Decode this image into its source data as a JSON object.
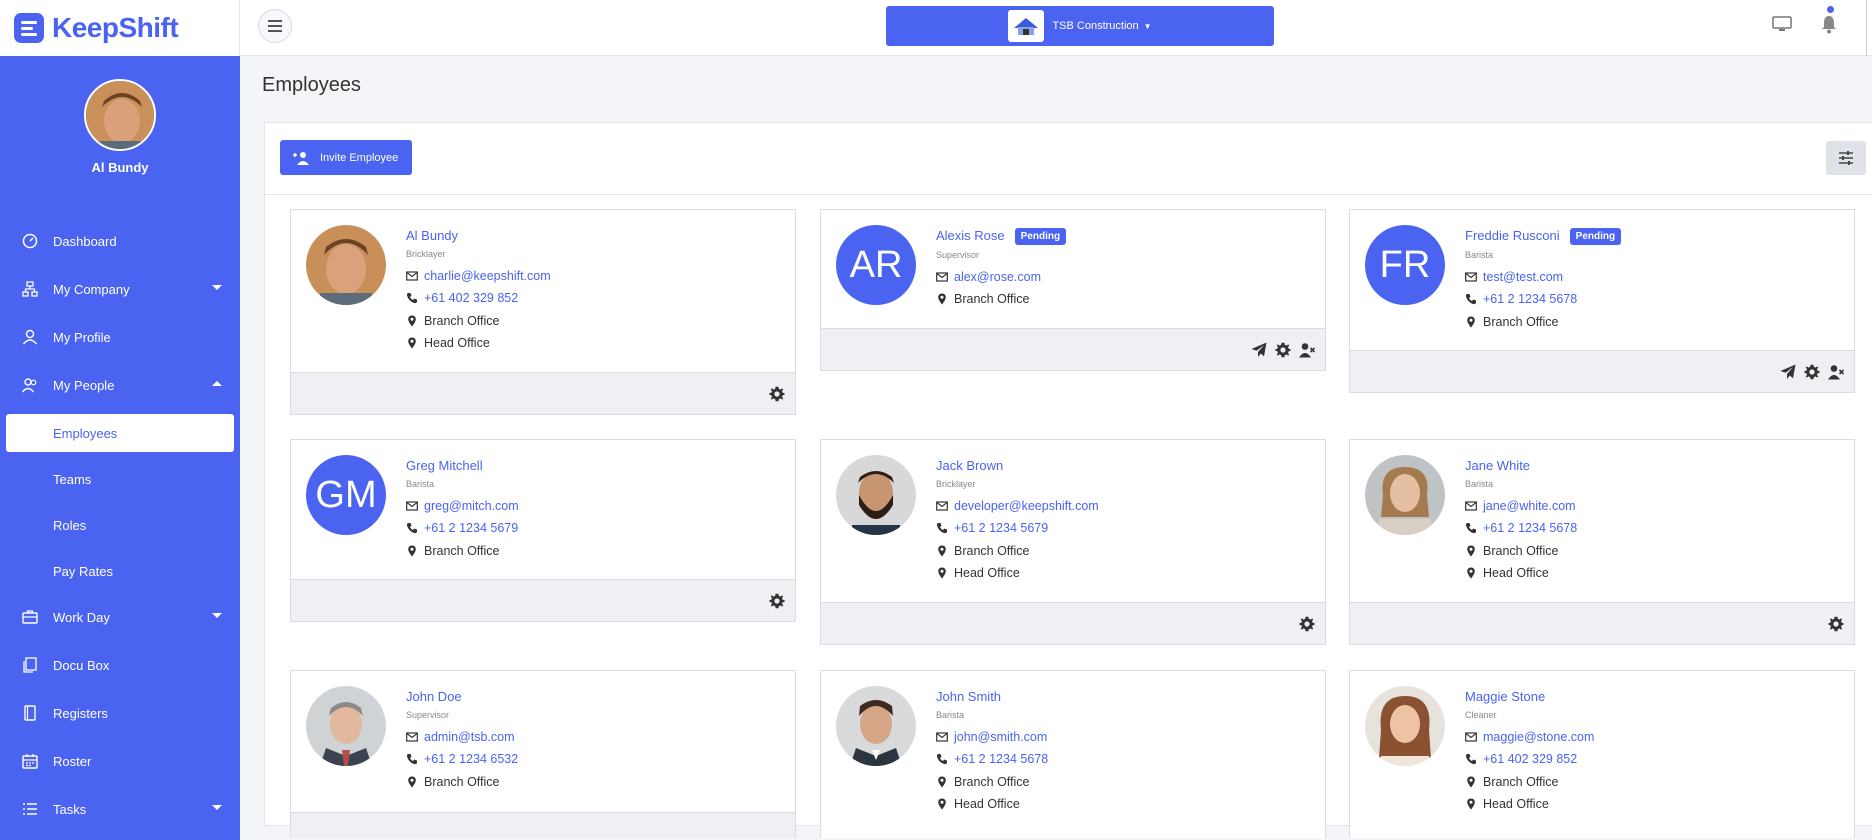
{
  "brand": {
    "name": "KeepShift"
  },
  "topbar": {
    "company": "TSB Construction"
  },
  "sidebar": {
    "user_name": "Al Bundy",
    "items": [
      {
        "label": "Dashboard"
      },
      {
        "label": "My Company"
      },
      {
        "label": "My Profile"
      },
      {
        "label": "My People"
      },
      {
        "label": "Employees"
      },
      {
        "label": "Teams"
      },
      {
        "label": "Roles"
      },
      {
        "label": "Pay Rates"
      },
      {
        "label": "Work Day"
      },
      {
        "label": "Docu Box"
      },
      {
        "label": "Registers"
      },
      {
        "label": "Roster"
      },
      {
        "label": "Tasks"
      }
    ]
  },
  "page": {
    "title": "Employees",
    "invite_label": "Invite Employee"
  },
  "employees": [
    {
      "name": "Al Bundy",
      "role": "Bricklayer",
      "email": "charlie@keepshift.com",
      "phone": "+61 402 329 852",
      "locations": [
        "Branch Office",
        "Head Office"
      ]
    },
    {
      "name": "Alexis Rose",
      "badge": "Pending",
      "initials": "AR",
      "role": "Supervisor",
      "email": "alex@rose.com",
      "locations": [
        "Branch Office"
      ]
    },
    {
      "name": "Freddie Rusconi",
      "badge": "Pending",
      "initials": "FR",
      "role": "Barista",
      "email": "test@test.com",
      "phone": "+61 2 1234 5678",
      "locations": [
        "Branch Office"
      ]
    },
    {
      "name": "Greg Mitchell",
      "initials": "GM",
      "role": "Barista",
      "email": "greg@mitch.com",
      "phone": "+61 2 1234 5679",
      "locations": [
        "Branch Office"
      ]
    },
    {
      "name": "Jack Brown",
      "role": "Bricklayer",
      "email": "developer@keepshift.com",
      "phone": "+61 2 1234 5679",
      "locations": [
        "Branch Office",
        "Head Office"
      ]
    },
    {
      "name": "Jane White",
      "role": "Barista",
      "email": "jane@white.com",
      "phone": "+61 2 1234 5678",
      "locations": [
        "Branch Office",
        "Head Office"
      ]
    },
    {
      "name": "John Doe",
      "role": "Supervisor",
      "email": "admin@tsb.com",
      "phone": "+61 2 1234 6532",
      "locations": [
        "Branch Office"
      ]
    },
    {
      "name": "John Smith",
      "role": "Barista",
      "email": "john@smith.com",
      "phone": "+61 2 1234 5678",
      "locations": [
        "Branch Office",
        "Head Office"
      ]
    },
    {
      "name": "Maggie Stone",
      "role": "Cleaner",
      "email": "maggie@stone.com",
      "phone": "+61 402 329 852",
      "locations": [
        "Branch Office",
        "Head Office"
      ]
    }
  ],
  "colors": {
    "accent": "#4a63f0",
    "footer": "#eef0f4"
  }
}
